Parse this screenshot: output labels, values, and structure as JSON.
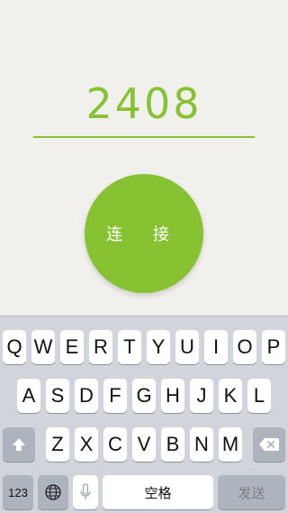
{
  "code_display": {
    "value": "2408"
  },
  "connect_button": {
    "label": "连 接"
  },
  "keyboard": {
    "row1": [
      "Q",
      "W",
      "E",
      "R",
      "T",
      "Y",
      "U",
      "I",
      "O",
      "P"
    ],
    "row2": [
      "A",
      "S",
      "D",
      "F",
      "G",
      "H",
      "J",
      "K",
      "L"
    ],
    "row3": [
      "Z",
      "X",
      "C",
      "V",
      "B",
      "N",
      "M"
    ],
    "numbers_label": "123",
    "space_label": "空格",
    "send_label": "发送",
    "shift_icon": "shift-arrow-icon",
    "delete_icon": "backspace-icon",
    "globe_icon": "globe-icon",
    "mic_icon": "microphone-icon"
  },
  "colors": {
    "accent": "#86c232",
    "keyboard_bg": "#d1d5db",
    "dark_key": "#aeb4be"
  }
}
